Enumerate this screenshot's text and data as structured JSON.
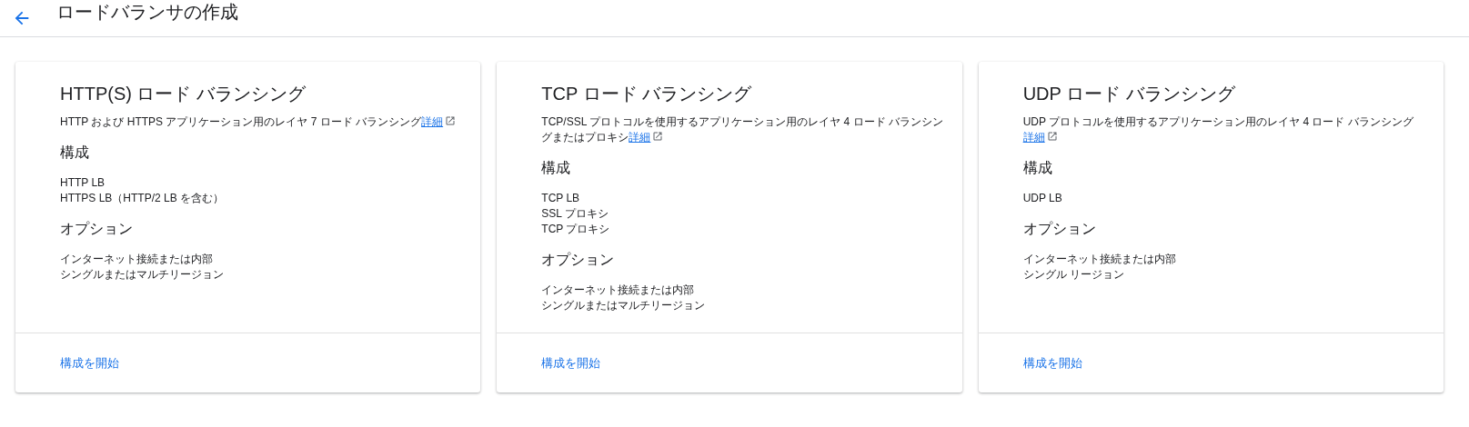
{
  "header": {
    "title": "ロードバランサの作成"
  },
  "cards": [
    {
      "title": "HTTP(S) ロード バランシング",
      "description": "HTTP および HTTPS アプリケーション用のレイヤ 7 ロード バランシング",
      "link": "詳細",
      "config_heading": "構成",
      "config_items": [
        "HTTP LB",
        "HTTPS LB（HTTP/2 LB を含む）"
      ],
      "options_heading": "オプション",
      "option_items": [
        "インターネット接続または内部",
        "シングルまたはマルチリージョン"
      ],
      "action": "構成を開始"
    },
    {
      "title": "TCP ロード バランシング",
      "description": "TCP/SSL プロトコルを使用するアプリケーション用のレイヤ 4 ロード バランシングまたはプロキシ",
      "link": "詳細",
      "config_heading": "構成",
      "config_items": [
        "TCP LB",
        "SSL プロキシ",
        "TCP プロキシ"
      ],
      "options_heading": "オプション",
      "option_items": [
        "インターネット接続または内部",
        "シングルまたはマルチリージョン"
      ],
      "action": "構成を開始"
    },
    {
      "title": "UDP ロード バランシング",
      "description": "UDP プロトコルを使用するアプリケーション用のレイヤ 4 ロード バランシング",
      "link": "詳細",
      "config_heading": "構成",
      "config_items": [
        "UDP LB"
      ],
      "options_heading": "オプション",
      "option_items": [
        "インターネット接続または内部",
        "シングル リージョン"
      ],
      "action": "構成を開始"
    }
  ]
}
